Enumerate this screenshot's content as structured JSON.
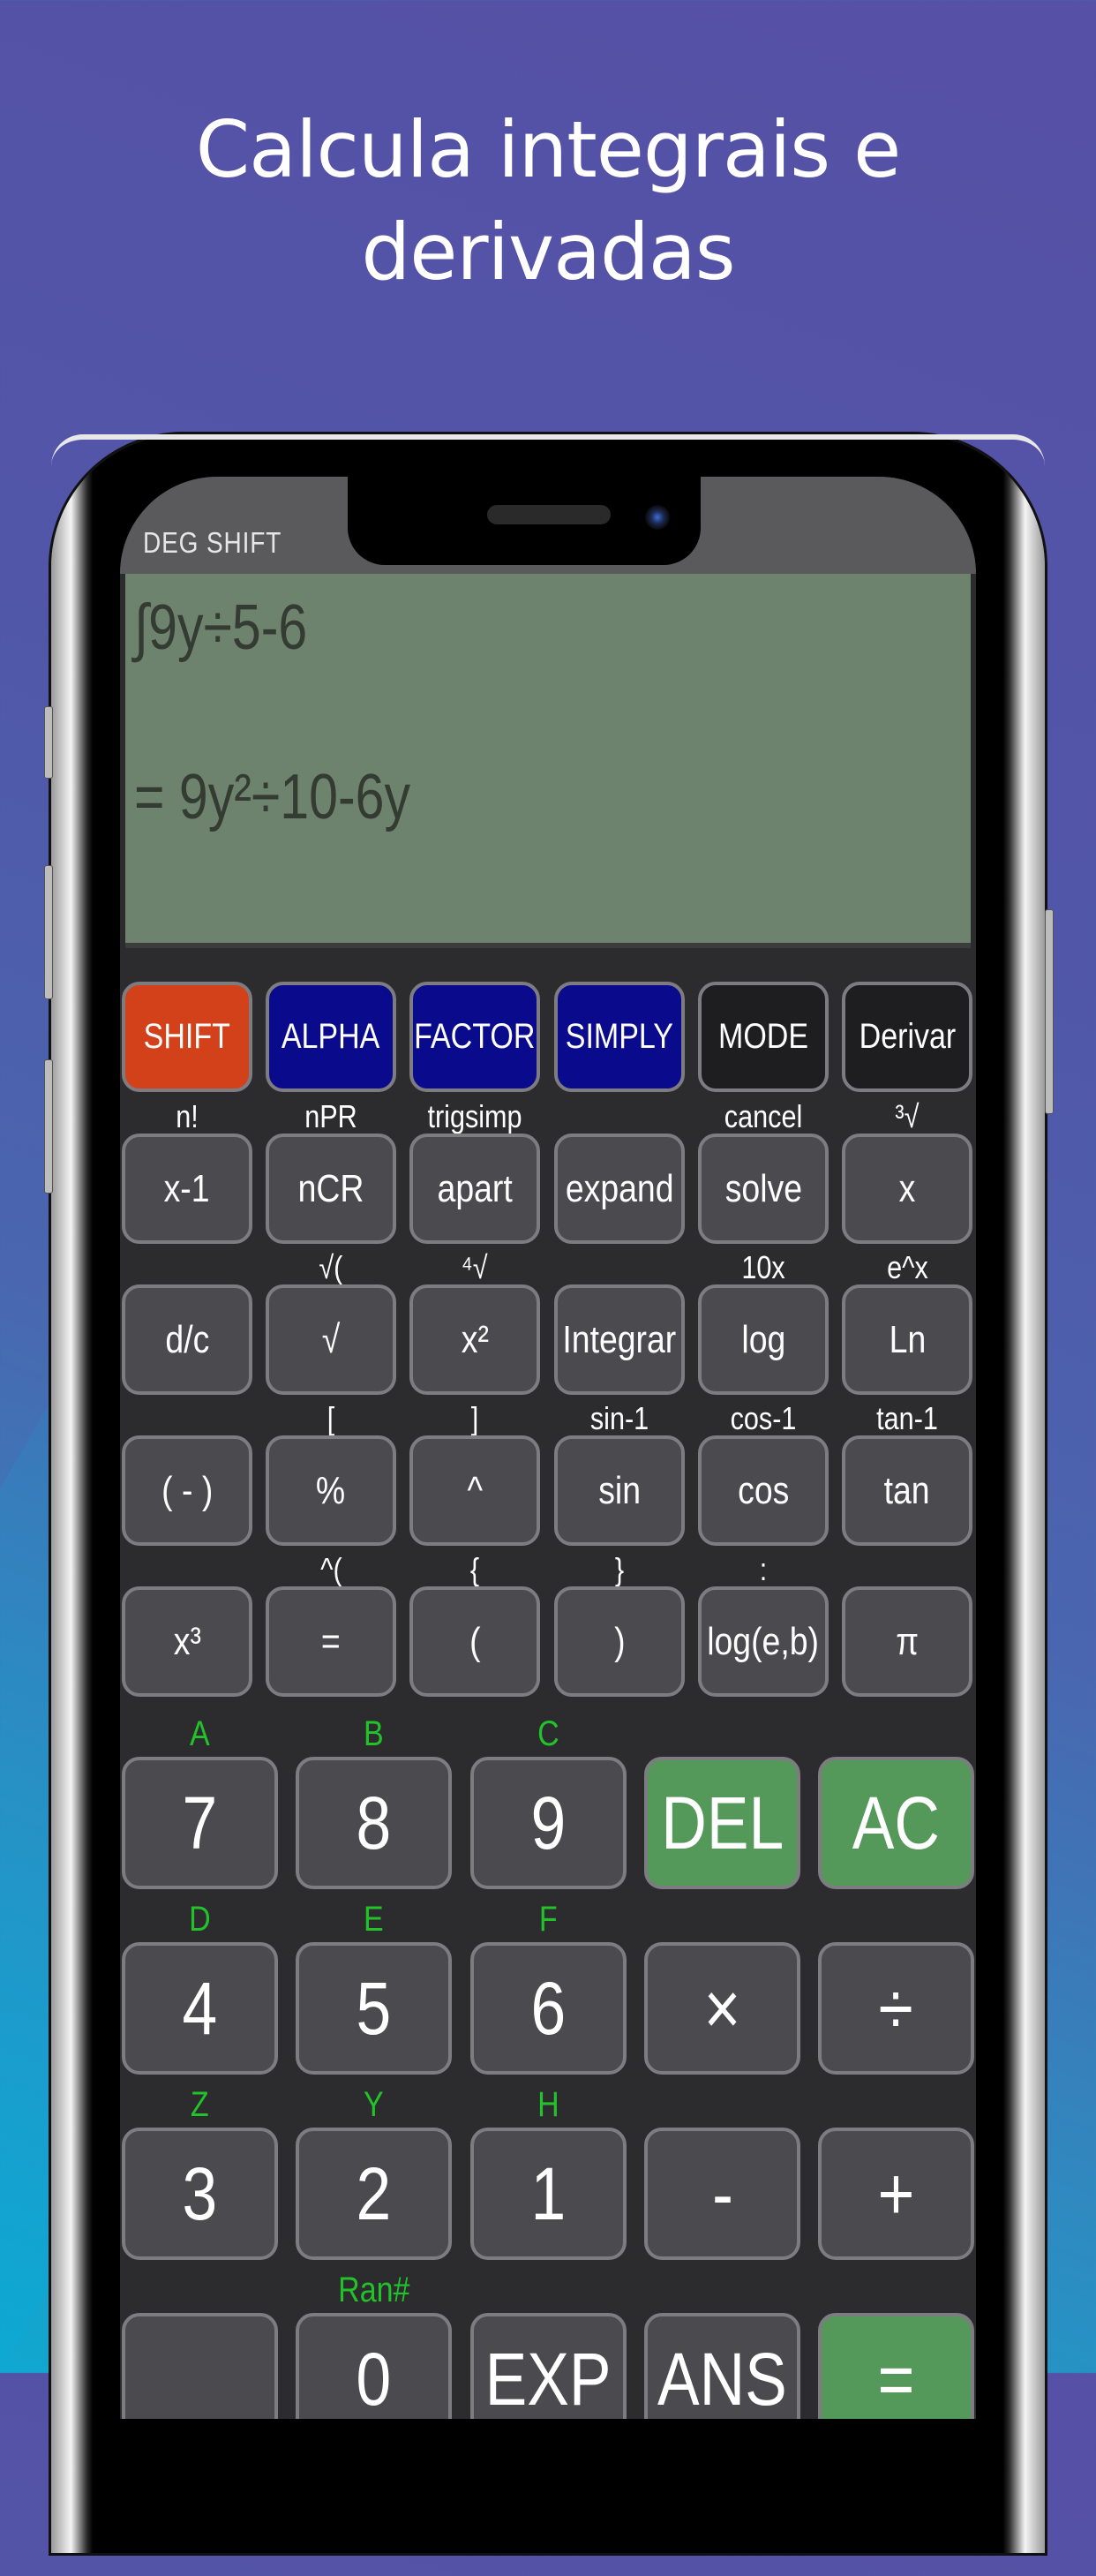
{
  "headline": {
    "line1": "Calcula integrais e",
    "line2": "derivadas"
  },
  "status_bar": {
    "text": "DEG SHIFT"
  },
  "display": {
    "input": "∫9y÷5-6",
    "result": "= 9y²÷10-6y"
  },
  "colors": {
    "shift": "#d3411a",
    "blue_keys": "#0a0a8c",
    "black_keys": "#1e1d20",
    "green_keys": "#55995a",
    "key_default": "#4b4a4e",
    "alpha_label": "#22c22a",
    "display_bg": "#6e836d"
  },
  "top_row": [
    "SHIFT",
    "ALPHA",
    "FACTOR",
    "SIMPLY",
    "MODE",
    "Derivar"
  ],
  "func_rows": [
    {
      "shift_labels": [
        "n!",
        "nPR",
        "trigsimp",
        "",
        "cancel",
        "³√"
      ],
      "keys": [
        "x-1",
        "nCR",
        "apart",
        "expand",
        "solve",
        "x"
      ]
    },
    {
      "shift_labels": [
        "",
        "√(",
        "⁴√",
        "",
        "10x",
        "e^x"
      ],
      "keys": [
        "d/c",
        "√",
        "x²",
        "Integrar",
        "log",
        "Ln"
      ]
    },
    {
      "shift_labels": [
        "",
        "[",
        "]",
        "sin-1",
        "cos-1",
        "tan-1"
      ],
      "keys": [
        "( - )",
        "%",
        "^",
        "sin",
        "cos",
        "tan"
      ]
    },
    {
      "shift_labels": [
        "",
        "^(",
        "{",
        "}",
        ":",
        ""
      ],
      "keys": [
        "x³",
        "=",
        "(",
        ")",
        "log(e,b)",
        "π"
      ]
    }
  ],
  "num_rows": [
    {
      "alpha_labels": [
        "A",
        "B",
        "C",
        "",
        ""
      ],
      "keys": [
        "7",
        "8",
        "9",
        "DEL",
        "AC"
      ]
    },
    {
      "alpha_labels": [
        "D",
        "E",
        "F",
        "",
        ""
      ],
      "keys": [
        "4",
        "5",
        "6",
        "×",
        "÷"
      ]
    },
    {
      "alpha_labels": [
        "Z",
        "Y",
        "H",
        "",
        ""
      ],
      "keys": [
        "3",
        "2",
        "1",
        "-",
        "+"
      ]
    },
    {
      "alpha_labels": [
        "",
        "Ran#",
        "",
        "",
        ""
      ],
      "keys": [
        "",
        "0",
        "EXP",
        "ANS",
        "="
      ]
    }
  ]
}
